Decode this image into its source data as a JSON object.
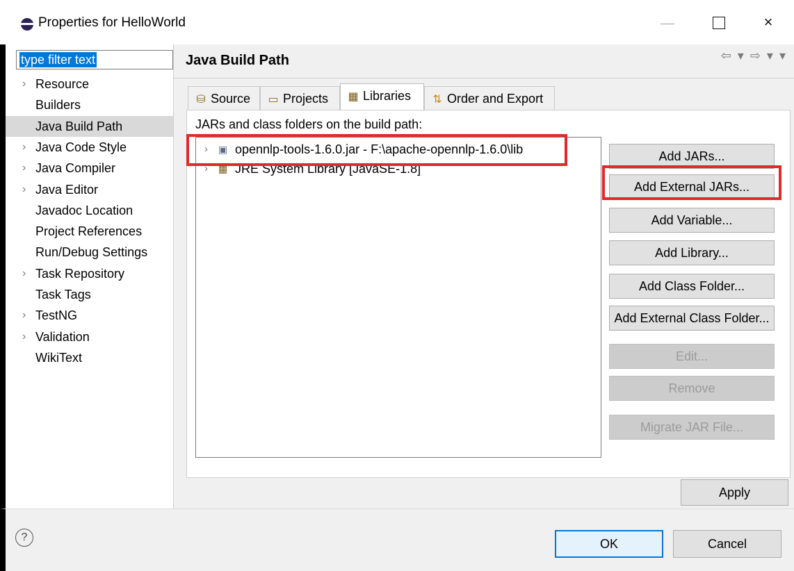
{
  "window": {
    "title": "Properties for HelloWorld",
    "icon": "eclipse-icon",
    "controls": {
      "minimize": "minimize-icon",
      "maximize": "maximize-icon",
      "close": "×"
    }
  },
  "sidebar": {
    "filter_text": "type filter text",
    "items": [
      {
        "label": "Resource",
        "expandable": true
      },
      {
        "label": "Builders",
        "expandable": false
      },
      {
        "label": "Java Build Path",
        "expandable": false,
        "selected": true
      },
      {
        "label": "Java Code Style",
        "expandable": true
      },
      {
        "label": "Java Compiler",
        "expandable": true
      },
      {
        "label": "Java Editor",
        "expandable": true
      },
      {
        "label": "Javadoc Location",
        "expandable": false
      },
      {
        "label": "Project References",
        "expandable": false
      },
      {
        "label": "Run/Debug Settings",
        "expandable": false
      },
      {
        "label": "Task Repository",
        "expandable": true
      },
      {
        "label": "Task Tags",
        "expandable": false
      },
      {
        "label": "TestNG",
        "expandable": true
      },
      {
        "label": "Validation",
        "expandable": true
      },
      {
        "label": "WikiText",
        "expandable": false
      }
    ],
    "arrow_glyph": "›"
  },
  "main": {
    "title": "Java Build Path",
    "nav_glyphs": "⇦ ▾ ⇨ ▾ ▾",
    "tabs": [
      {
        "label": "Source",
        "icon_glyph": "⛁"
      },
      {
        "label": "Projects",
        "icon_glyph": "▭"
      },
      {
        "label": "Libraries",
        "icon_glyph": "▦",
        "active": true
      },
      {
        "label": "Order and Export",
        "icon_glyph": "⇅"
      }
    ],
    "section_label": "JARs and class folders on the build path:",
    "libraries": [
      {
        "label": "opennlp-tools-1.6.0.jar - F:\\apache-opennlp-1.6.0\\lib",
        "icon_glyph": "▣"
      },
      {
        "label": "JRE System Library [JavaSE-1.8]",
        "icon_glyph": "▦"
      }
    ],
    "buttons": [
      {
        "label": "Add JARs...",
        "enabled": true
      },
      {
        "label": "Add External JARs...",
        "enabled": true
      },
      {
        "label": "Add Variable...",
        "enabled": true
      },
      {
        "label": "Add Library...",
        "enabled": true
      },
      {
        "label": "Add Class Folder...",
        "enabled": true
      },
      {
        "label": "Add External Class Folder...",
        "enabled": true
      },
      {
        "label": "Edit...",
        "enabled": false
      },
      {
        "label": "Remove",
        "enabled": false
      },
      {
        "label": "Migrate JAR File...",
        "enabled": false
      }
    ],
    "apply_label": "Apply"
  },
  "footer": {
    "help_glyph": "?",
    "ok_label": "OK",
    "cancel_label": "Cancel"
  },
  "colors": {
    "highlight": "#e02a2a",
    "selection": "#0078d7"
  }
}
